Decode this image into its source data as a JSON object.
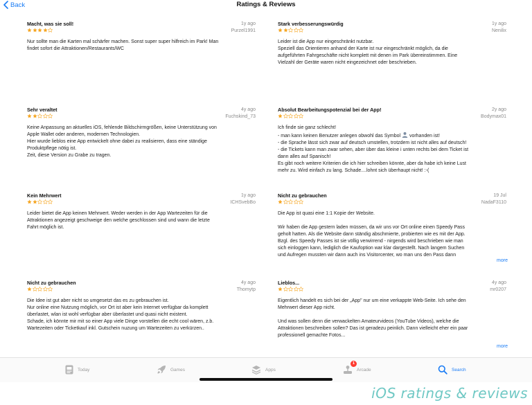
{
  "nav": {
    "back_label": "Back",
    "title": "Ratings & Reviews"
  },
  "colors": {
    "accent": "#1a7cf5",
    "star": "#f5a623",
    "star_empty": "#f5a623",
    "badge": "#ff3b30",
    "watermark": "#6fc8c4"
  },
  "reviews": [
    {
      "title": "Macht, was sie soll!",
      "date": "1y ago",
      "author": "Purzel1991",
      "rating": 4,
      "body": "Nur sollte man die Karten mal schärfer machen. Sonst super super hilfreich im Park! Man\nfindet sofort die Attraktionen/Restaurants/WC"
    },
    {
      "title": "Stark verbesserungswürdig",
      "date": "1y ago",
      "author": "Nenilix",
      "rating": 2,
      "body": "Leider ist die App nur eingeschränkt nutzbar.\nSpeziell das Orientieren anhand der Karte ist nur eingeschränkt möglich, da die\naufgeführten Fahrgeschäfte nicht komplett mit denen im Park übereinstimmen. Eine\nVielzahl der Geräte waren nicht eingezeichnet oder beschrieben."
    },
    {
      "title": "Sehr veraltet",
      "date": "4y ago",
      "author": "Fuchskind_73",
      "rating": 2,
      "body": "Keine Anpassung an aktuelles iOS, fehlende Bildschirmgrößen, keine Unterstützung von\nApple Wallet oder anderen, modernen Technologien.\nHier wurde lieblos eine App entwickelt ohne dabei zu realisieren, dass eine ständige\nProduktpflege nötig ist.\nZeit, diese Version zu Grabe zu tragen."
    },
    {
      "title": "Absolut Bearbeitungspotenzial bei der App!",
      "date": "2y ago",
      "author": "Bodymax01",
      "rating": 1,
      "body_before_icon": "Ich finde sie ganz schlecht!\n- man kann keinen Benutzer anlegen obwohl das Symbol ",
      "body_after_icon": " vorhanden ist!\n- die Sprache lässt sich zwar auf deutsch umstellen, trotzdem ist nicht alles auf deutsch!\n- die Tickets kann man zwar sehen, aber über das kleine i unten rechts bei dem Ticket ist\ndann alles auf Spanisch!\nEs gibt noch weitere Kriterien die ich hier schreiben könnte, aber da habe ich keine Lust\nmehr zu. Wird einfach zu lang. Schade....lohnt sich überhaupt nicht! :-("
    },
    {
      "title": "Kein Mehrwert",
      "date": "1y ago",
      "author": "ICHSvebBo",
      "rating": 2,
      "body": "Leider bietet die App keinen Mehrwert. Weder werden in der App Wartezeiten für die\nAttraktionen  angezeigt geschweige den welche geschlossen sind und wann die letzte\nFahrt möglich ist."
    },
    {
      "title": "Nicht zu gebrauchen",
      "date": "19 Jul",
      "author": "NadaF3110",
      "rating": 1,
      "body": "Die App ist quasi eine 1:1 Kopie der Website.\n\nWir haben die App gestern laden müssen, da wir uns vor Ort online einen Speedy Pass\ngeholt hatten. Als die Website dann ständig abschmierte, probierten wie es mit der App.\nBzgl. des Speedy Passes ist sie völlig verwirrend - nirgends wird beschrieben wie man\nsich einloggen kann, lediglich die Kaufoption war klar dargestellt. Nach langem Suchen\nund Aufregen mussten wir dann auch ins Visitorcenter, wo man uns den Pass dann",
      "more": "more"
    },
    {
      "title": "Nicht zu gebrauchen",
      "date": "4y ago",
      "author": "Thomytp",
      "rating": 1,
      "body": "Die Idee ist gut aber nicht so umgesetzt das es zu gebrauchen ist.\nNur online eine Nutzung möglich, vor Ort ist aber kein Internet verfügbar da komplett\nüberlastet, wlan ist wohl verfügbar aber überlastet und quasi nicht existent.\nSchade, ich könnte mir mit so einer App viele Dinge vorstellen die echt cool wären, z.b.\nWartezeiten oder Ticketkauf inkl. Gutschein nuzung um Wartezeiten zu verkürzen.."
    },
    {
      "title": "Lieblos...",
      "date": "4y ago",
      "author": "mr0207",
      "rating": 1,
      "body": "Eigentlich handelt es sich bei der „App\" nur um eine verkappte Web-Seite. Ich sehe den\nMehrwert dieser App nicht.\n\nUnd was sollen denn die verwackelten Amateurvideos (YouTube Videos), welche die\nAttraktionen beschreiben sollen? Das ist geradezu peinlich. Dann vielleicht eher ein paar\nprofessionell gemachte Fotos...",
      "more": "more"
    }
  ],
  "tabs": [
    {
      "label": "Today",
      "icon": "today-icon"
    },
    {
      "label": "Games",
      "icon": "games-rocket-icon"
    },
    {
      "label": "Apps",
      "icon": "apps-layers-icon"
    },
    {
      "label": "Arcade",
      "icon": "arcade-joystick-icon",
      "badge": "1"
    },
    {
      "label": "Search",
      "icon": "search-icon",
      "active": true
    }
  ],
  "watermark": "iOS ratings & reviews"
}
